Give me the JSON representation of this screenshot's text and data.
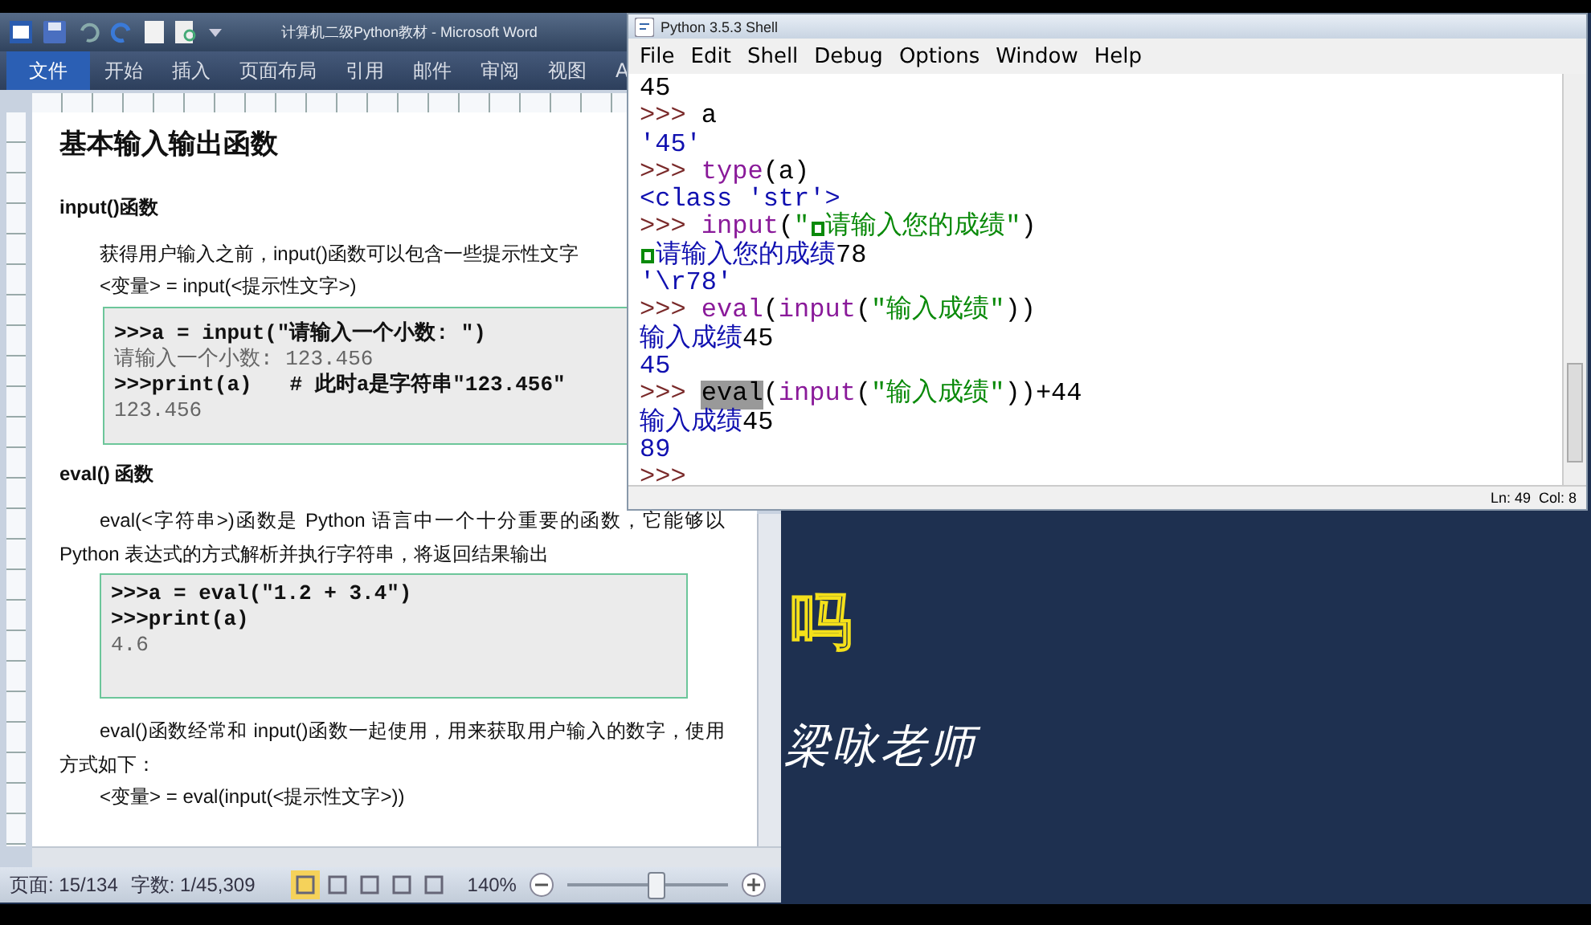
{
  "word_window": {
    "title": "计算机二级Python教材 - Microsoft Word",
    "ribbon_tabs": [
      {
        "label": "文件",
        "selected": true
      },
      {
        "label": "开始",
        "selected": false
      },
      {
        "label": "插入",
        "selected": false
      },
      {
        "label": "页面布局",
        "selected": false
      },
      {
        "label": "引用",
        "selected": false
      },
      {
        "label": "邮件",
        "selected": false
      },
      {
        "label": "审阅",
        "selected": false
      },
      {
        "label": "视图",
        "selected": false
      },
      {
        "label": "A",
        "selected": false
      }
    ],
    "document": [
      {
        "kind": "heading",
        "text": "基本输入输出函数"
      },
      {
        "kind": "subheading",
        "text": "input()函数"
      },
      {
        "kind": "paragraph",
        "text": "获得用户输入之前，input()函数可以包含一些提示性文字"
      },
      {
        "kind": "syntax",
        "text": "<变量> = input(<提示性文字>)"
      },
      {
        "kind": "code",
        "lines": [
          {
            "kind": "input",
            "text": ">>>a = input(\"请输入一个小数: \")"
          },
          {
            "kind": "output",
            "text": "请输入一个小数: 123.456"
          },
          {
            "kind": "input",
            "text": ">>>print(a)   # 此时a是字符串\"123.456\""
          },
          {
            "kind": "output",
            "text": "123.456"
          }
        ]
      },
      {
        "kind": "subheading",
        "text": "eval() 函数"
      },
      {
        "kind": "paragraph",
        "text": "eval(<字符串>)函数是 Python 语言中一个十分重要的函数，它能够以 Python 表达式的方式解析并执行字符串，将返回结果输出"
      },
      {
        "kind": "code",
        "lines": [
          {
            "kind": "input",
            "text": ">>>a = eval(\"1.2 + 3.4\")"
          },
          {
            "kind": "input",
            "text": ">>>print(a)"
          },
          {
            "kind": "output",
            "text": "4.6"
          }
        ]
      },
      {
        "kind": "paragraph",
        "text": "eval()函数经常和 input()函数一起使用，用来获取用户输入的数字，使用方式如下："
      },
      {
        "kind": "syntax",
        "text": "<变量> = eval(input(<提示性文字>))"
      }
    ],
    "status_bar": {
      "page": "页面: 15/134",
      "words": "字数: 1/45,309",
      "view_buttons": [
        {
          "selected": true
        },
        {
          "selected": false
        },
        {
          "selected": false
        },
        {
          "selected": false
        },
        {
          "selected": false
        }
      ],
      "zoom": "140%",
      "zoom_slider": {
        "level": 0.55
      }
    }
  },
  "shell_window": {
    "title": "Python 3.5.3 Shell",
    "menu": [
      "File",
      "Edit",
      "Shell",
      "Debug",
      "Options",
      "Window",
      "Help"
    ],
    "lines": [
      [
        {
          "kind": "plain",
          "text": "45"
        }
      ],
      [
        {
          "kind": "prompt",
          "text": ">>> "
        },
        {
          "kind": "plain",
          "text": "a"
        }
      ],
      [
        {
          "kind": "result",
          "text": "'45'"
        }
      ],
      [
        {
          "kind": "prompt",
          "text": ">>> "
        },
        {
          "kind": "builtin",
          "text": "type"
        },
        {
          "kind": "plain",
          "text": "(a)"
        }
      ],
      [
        {
          "kind": "result",
          "text": "<class 'str'>"
        }
      ],
      [
        {
          "kind": "prompt",
          "text": ">>> "
        },
        {
          "kind": "builtin",
          "text": "input"
        },
        {
          "kind": "plain",
          "text": "("
        },
        {
          "kind": "string",
          "text": "\""
        },
        {
          "kind": "control_char"
        },
        {
          "kind": "string",
          "text": "请输入您的成绩\""
        },
        {
          "kind": "plain",
          "text": ")"
        }
      ],
      [
        {
          "kind": "control_char"
        },
        {
          "kind": "result",
          "text": "请输入您的成绩"
        },
        {
          "kind": "plain",
          "text": "78"
        }
      ],
      [
        {
          "kind": "result",
          "text": "'\\r78'"
        }
      ],
      [
        {
          "kind": "prompt",
          "text": ">>> "
        },
        {
          "kind": "builtin",
          "text": "eval"
        },
        {
          "kind": "plain",
          "text": "("
        },
        {
          "kind": "builtin",
          "text": "input"
        },
        {
          "kind": "plain",
          "text": "("
        },
        {
          "kind": "string",
          "text": "\"输入成绩\""
        },
        {
          "kind": "plain",
          "text": "))"
        }
      ],
      [
        {
          "kind": "result",
          "text": "输入成绩"
        },
        {
          "kind": "plain",
          "text": "45"
        }
      ],
      [
        {
          "kind": "result",
          "text": "45"
        }
      ],
      [
        {
          "kind": "prompt",
          "text": ">>> "
        },
        {
          "kind": "selection",
          "text": "eval"
        },
        {
          "kind": "plain",
          "text": "("
        },
        {
          "kind": "builtin",
          "text": "input"
        },
        {
          "kind": "plain",
          "text": "("
        },
        {
          "kind": "string",
          "text": "\"输入成绩\""
        },
        {
          "kind": "plain",
          "text": "))+44"
        }
      ],
      [
        {
          "kind": "result",
          "text": "输入成绩"
        },
        {
          "kind": "plain",
          "text": "45"
        }
      ],
      [
        {
          "kind": "result",
          "text": "89"
        }
      ],
      [
        {
          "kind": "prompt",
          "text": ">>>"
        }
      ]
    ],
    "status": "Ln: 49  Col: 8"
  },
  "overlay_text": [
    {
      "kind": "caption",
      "text": "吗"
    },
    {
      "kind": "signature",
      "text": "梁咏老师"
    }
  ]
}
